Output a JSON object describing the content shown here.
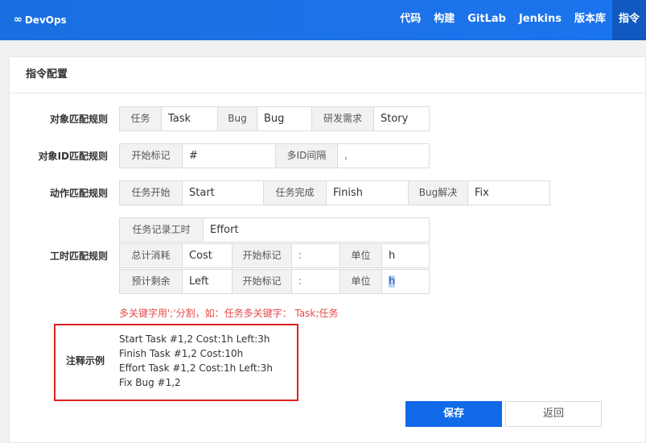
{
  "header": {
    "logo_icon": "∞",
    "logo_text": "DevOps",
    "nav": [
      {
        "label": "代码",
        "active": false
      },
      {
        "label": "构建",
        "active": false
      },
      {
        "label": "GitLab",
        "active": false
      },
      {
        "label": "Jenkins",
        "active": false
      },
      {
        "label": "版本库",
        "active": false
      },
      {
        "label": "指令",
        "active": true
      }
    ]
  },
  "panel": {
    "title": "指令配置"
  },
  "object_rule": {
    "label": "对象匹配规则",
    "task_addon": "任务",
    "task_value": "Task",
    "bug_addon": "Bug",
    "bug_value": "Bug",
    "story_addon": "研发需求",
    "story_value": "Story"
  },
  "id_rule": {
    "label": "对象ID匹配规则",
    "start_addon": "开始标记",
    "start_value": "#",
    "sep_addon": "多ID间隔",
    "sep_value": ","
  },
  "action_rule": {
    "label": "动作匹配规则",
    "start_addon": "任务开始",
    "start_value": "Start",
    "finish_addon": "任务完成",
    "finish_value": "Finish",
    "fix_addon": "Bug解决",
    "fix_value": "Fix"
  },
  "hours_rule": {
    "label": "工时匹配规则",
    "effort_addon": "任务记录工时",
    "effort_value": "Effort",
    "cost_addon": "总计消耗",
    "cost_value": "Cost",
    "cost_start_addon": "开始标记",
    "cost_start_value": ":",
    "cost_unit_addon": "单位",
    "cost_unit_value": "h",
    "left_addon": "预计剩余",
    "left_value": "Left",
    "left_start_addon": "开始标记",
    "left_start_value": ":",
    "left_unit_addon": "单位",
    "left_unit_value": "h"
  },
  "hint": "多关键字用';'分割，如：任务多关键字： Task;任务",
  "example": {
    "label": "注释示例",
    "lines": [
      "Start Task #1,2 Cost:1h Left:3h",
      "Finish Task #1,2 Cost:10h",
      "Effort Task #1,2 Cost:1h Left:3h",
      "Fix Bug #1,2"
    ]
  },
  "buttons": {
    "save": "保存",
    "back": "返回"
  },
  "colors": {
    "header_blue": "#1a6fe0",
    "active_nav": "#1158c0",
    "primary": "#1069e6",
    "hint_red": "#e64a4a",
    "highlight_border": "#e02020"
  }
}
